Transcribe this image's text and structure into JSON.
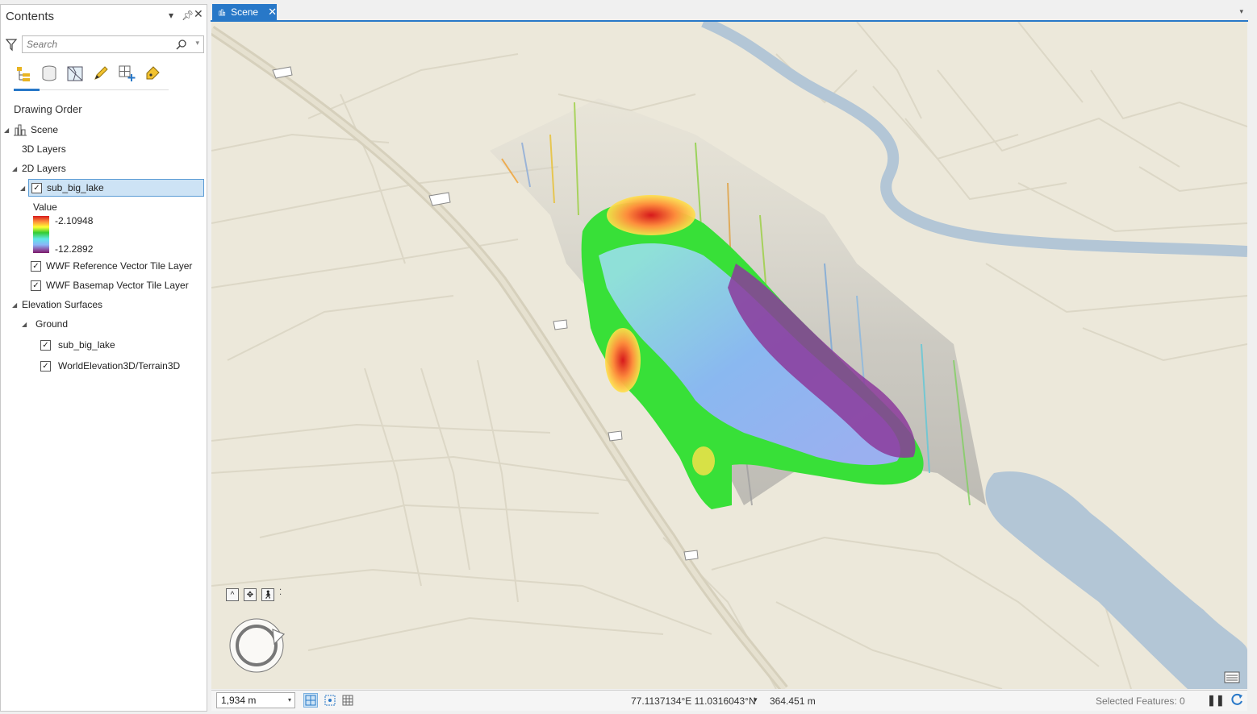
{
  "contents": {
    "title": "Contents",
    "search_placeholder": "Search",
    "section_title": "Drawing Order",
    "tree": {
      "scene": "Scene",
      "layers_3d": "3D Layers",
      "layers_2d": "2D Layers",
      "sub_big_lake": "sub_big_lake",
      "legend_field": "Value",
      "legend_high": "-2.10948",
      "legend_low": "-12.2892",
      "wwf_reference": "WWF Reference Vector Tile Layer",
      "wwf_basemap": "WWF Basemap Vector Tile Layer",
      "elevation_surfaces": "Elevation Surfaces",
      "ground": "Ground",
      "ground_sub_big_lake": "sub_big_lake",
      "world_elevation": "WorldElevation3D/Terrain3D"
    }
  },
  "scene_tab": {
    "label": "Scene"
  },
  "statusbar": {
    "scale": "1,934 m",
    "coordinates": "77.1137134°E 11.0316043°N",
    "elevation": "364.451 m",
    "selected_features": "Selected Features: 0"
  },
  "colors": {
    "accent": "#2878c8",
    "map_background": "#ece8da",
    "water": "#b3c6d6",
    "selection": "#cde3f5"
  },
  "icons": [
    "filter-icon",
    "search-icon",
    "list-by-drawing-order-icon",
    "list-by-data-source-icon",
    "list-by-type-icon",
    "list-by-editing-icon",
    "list-by-selection-icon",
    "list-by-labeling-icon",
    "scene-icon",
    "pin-icon",
    "close-icon",
    "navigator-icon",
    "basemap-icon",
    "refresh-icon"
  ]
}
